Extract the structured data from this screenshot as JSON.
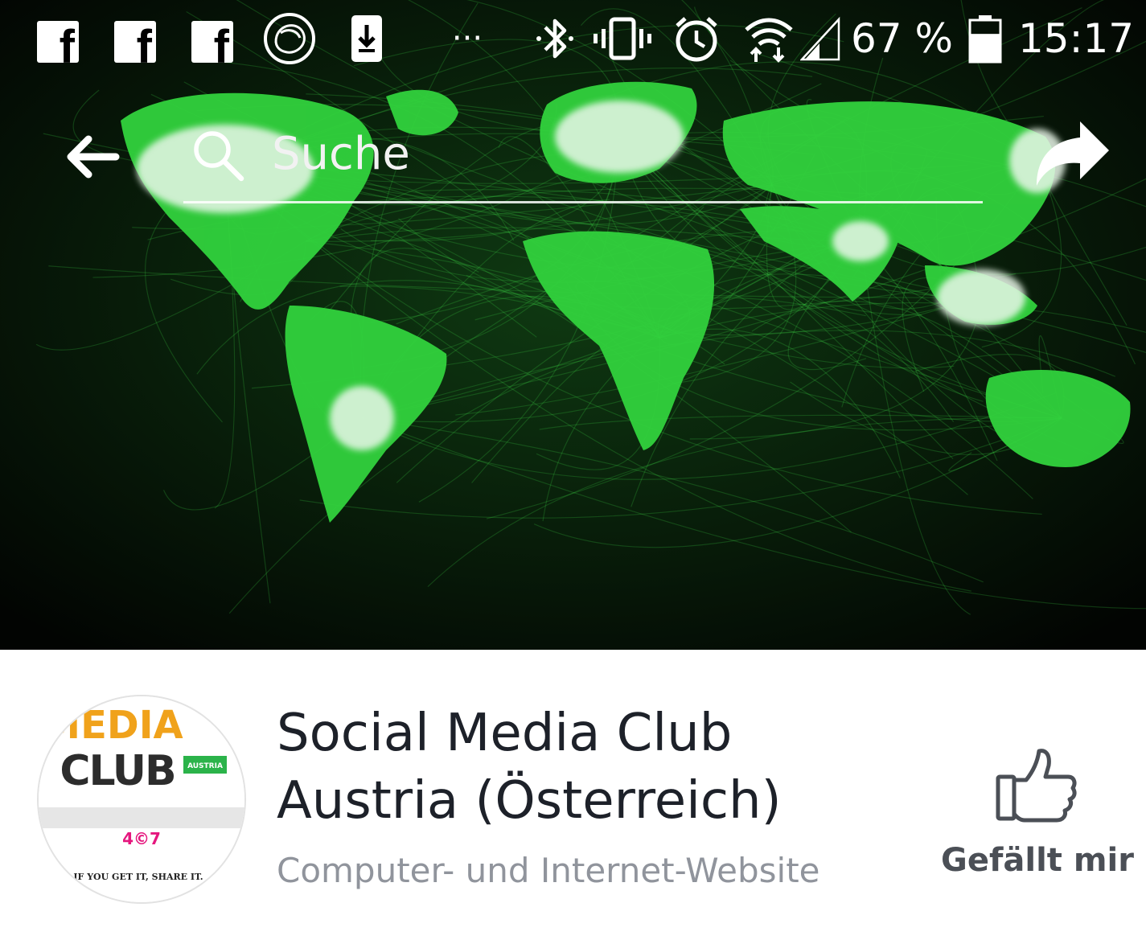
{
  "status_bar": {
    "notification_icons": [
      "facebook-icon",
      "facebook-icon",
      "facebook-icon",
      "app-circle-icon",
      "download-icon",
      "more-dots-icon"
    ],
    "facebook_glyph": "f",
    "dots": "···",
    "system_icons": [
      "bluetooth-icon",
      "vibrate-icon",
      "alarm-icon",
      "wifi-icon",
      "signal-icon"
    ],
    "battery_percent": "67 %",
    "battery_level": 0.67,
    "time": "15:17"
  },
  "toolbar": {
    "back_icon": "arrow-left-icon",
    "search_icon": "search-icon",
    "search_placeholder": "Suche",
    "share_icon": "share-icon"
  },
  "cover": {
    "image": "green world map network"
  },
  "profile": {
    "avatar": {
      "line1": "MEDIA",
      "line2": "CLUB",
      "badge": "AUSTRIA",
      "mark": "4©7",
      "slogan": "IF YOU GET IT, SHARE IT."
    },
    "name_line1": "Social Media Club",
    "name_line2": "Austria (Österreich)",
    "category": "Computer- und Internet-Website",
    "like_label": "Gefällt mir",
    "like_icon": "thumbs-up-icon"
  },
  "colors": {
    "map_green": "#2fd13a",
    "name_text": "#1d2129",
    "category_text": "#90949c",
    "like_text": "#4b4f56",
    "badge_green": "#2bb34a",
    "mark_pink": "#e5177e"
  }
}
